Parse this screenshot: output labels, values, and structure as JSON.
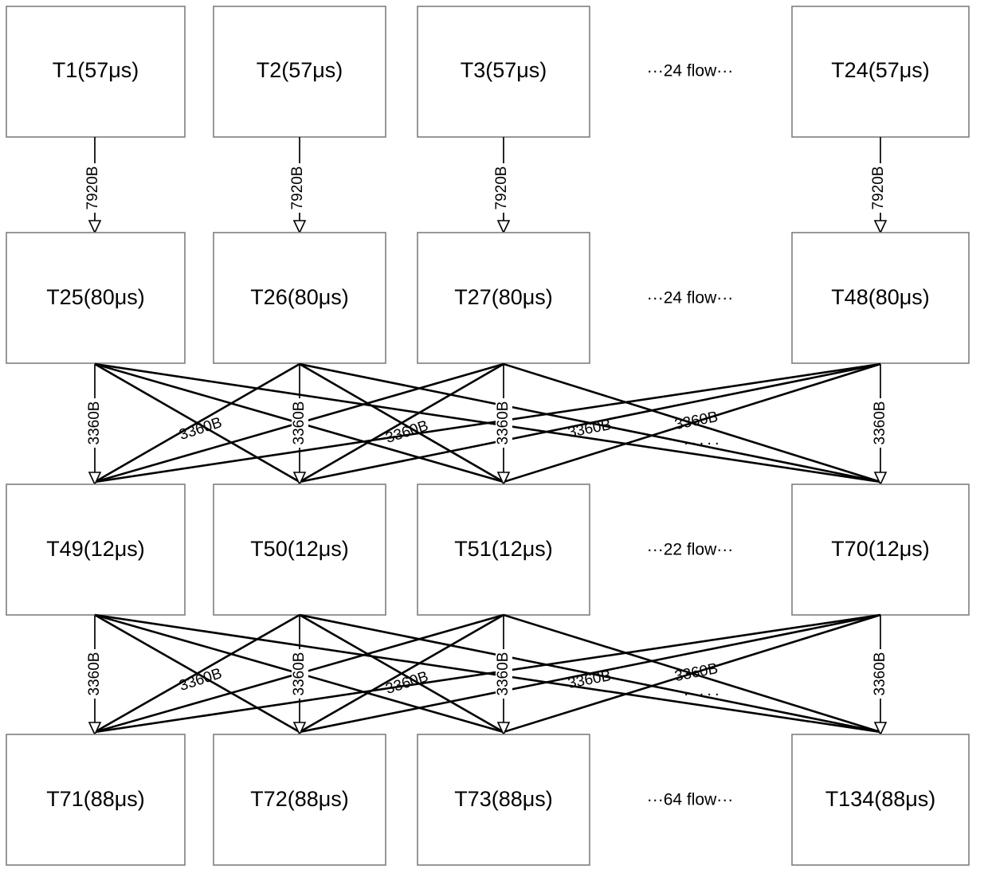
{
  "diagram": {
    "title": "task-flow-dag",
    "colors": {
      "node_stroke": "#7f7f7f",
      "edge_stroke": "#000000",
      "background": "#ffffff",
      "text": "#000000"
    },
    "rows": [
      {
        "id": "row-1",
        "flow_note": "···24 flow···",
        "nodes": [
          {
            "label": "T1(57μs)"
          },
          {
            "label": "T2(57μs)"
          },
          {
            "label": "T3(57μs)"
          },
          {
            "label": "T24(57μs)"
          }
        ]
      },
      {
        "id": "row-2",
        "flow_note": "···24 flow···",
        "nodes": [
          {
            "label": "T25(80μs)"
          },
          {
            "label": "T26(80μs)"
          },
          {
            "label": "T27(80μs)"
          },
          {
            "label": "T48(80μs)"
          }
        ]
      },
      {
        "id": "row-3",
        "flow_note": "···22 flow···",
        "nodes": [
          {
            "label": "T49(12μs)"
          },
          {
            "label": "T50(12μs)"
          },
          {
            "label": "T51(12μs)"
          },
          {
            "label": "T70(12μs)"
          }
        ]
      },
      {
        "id": "row-4",
        "flow_note": "···64 flow···",
        "nodes": [
          {
            "label": "T71(88μs)"
          },
          {
            "label": "T72(88μs)"
          },
          {
            "label": "T73(88μs)"
          },
          {
            "label": "T134(88μs)"
          }
        ]
      }
    ],
    "edge_groups": [
      {
        "id": "edges-row1-row2",
        "kind": "parallel-vertical",
        "weight_label": "7920B",
        "labels": [
          "7920B",
          "7920B",
          "7920B",
          "7920B"
        ]
      },
      {
        "id": "edges-row2-row3",
        "kind": "all-to-all",
        "weight_label": "3360B",
        "labels": [
          "3360B",
          "3360B",
          "3360B",
          "3360B",
          "3360B",
          "3360B"
        ],
        "ellipsis": "·····"
      },
      {
        "id": "edges-row3-row4",
        "kind": "all-to-all",
        "weight_label": "3360B",
        "labels": [
          "3360B",
          "3360B",
          "3360B",
          "3360B",
          "3360B",
          "3360B"
        ],
        "ellipsis": "·····"
      }
    ]
  }
}
